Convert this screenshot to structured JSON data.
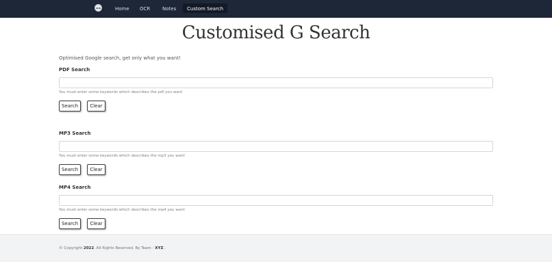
{
  "nav": {
    "logo_text": "OCR",
    "links": [
      "Home",
      "OCR",
      "Notes",
      "Custom Search"
    ]
  },
  "page": {
    "title": "Customised G Search",
    "subtitle": "Optimised Google search, get only what you want!"
  },
  "sections": [
    {
      "label": "PDF Search",
      "input_value": "",
      "help": "You must enter some keywords which describes the pdf you want",
      "search_label": "Search",
      "clear_label": "Clear"
    },
    {
      "label": "MP3 Search",
      "input_value": "",
      "help": "You must enter some keywords which describes the mp3 you want",
      "search_label": "Search",
      "clear_label": "Clear"
    },
    {
      "label": "MP4 Search",
      "input_value": "",
      "help": "You must enter some keywords which describes the mp4 you want",
      "search_label": "Search",
      "clear_label": "Clear"
    }
  ],
  "footer": {
    "prefix": "© Copyright ",
    "year": "2022",
    "middle": ". All Rights Reserved. By Team - ",
    "team": "XYZ",
    "suffix": " ."
  },
  "colors": {
    "navbar": "#1e2738",
    "active_tab": "#131a27",
    "footer_bg": "#f2f3f5"
  }
}
